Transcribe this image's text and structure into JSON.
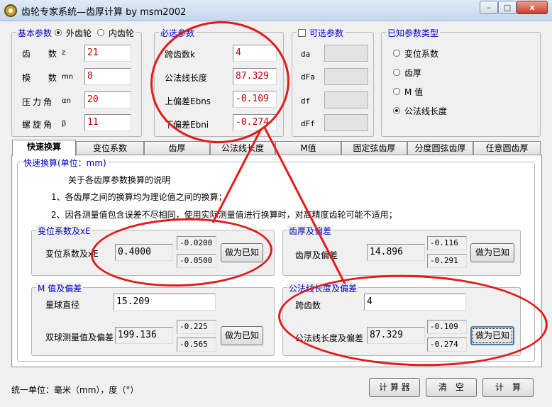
{
  "window": {
    "title": "齿轮专家系统—齿厚计算 by msm2002",
    "controls": [
      "–",
      "□",
      "x"
    ]
  },
  "basic_params": {
    "title": "基本参数",
    "gear_type_external": "外齿轮",
    "gear_type_internal": "内齿轮",
    "selected_gear_type": "外齿轮",
    "rows": [
      {
        "label": "齿　 数",
        "sub": "z",
        "value": "21"
      },
      {
        "label": "模　 数",
        "sub": "mn",
        "value": "8"
      },
      {
        "label": "压力角",
        "sub": "αn",
        "value": "20"
      },
      {
        "label": "螺旋角",
        "sub": "β",
        "value": "11"
      }
    ]
  },
  "required_params": {
    "title": "必选参数",
    "rows": [
      {
        "label": "跨齿数k",
        "value": "4"
      },
      {
        "label": "公法线长度",
        "value": "87.329"
      },
      {
        "label": "上偏差Ebns",
        "value": "-0.109"
      },
      {
        "label": "下偏差Ebni",
        "value": "-0.274"
      }
    ]
  },
  "optional_params": {
    "title": "可选参数",
    "checked": false,
    "rows": [
      {
        "label": "da",
        "value": ""
      },
      {
        "label": "dFa",
        "value": ""
      },
      {
        "label": "df",
        "value": ""
      },
      {
        "label": "dFf",
        "value": ""
      }
    ]
  },
  "known_param_type": {
    "title": "已知参数类型",
    "options": [
      "变位系数",
      "齿厚",
      "M 值",
      "公法线长度"
    ],
    "selected": "公法线长度"
  },
  "tabs": [
    "快速换算",
    "变位系数",
    "齿厚",
    "公法线长度",
    "M值",
    "固定弦齿厚",
    "分度圆弦齿厚",
    "任意圆齿厚"
  ],
  "active_tab": "快速换算",
  "quick": {
    "title": "快速换算(单位：mm)",
    "notes_title": "关于各齿厚参数换算的说明",
    "note1": "1、各齿厚之间的换算均为理论值之间的换算；",
    "note2": "2、因各测量值包含误差不尽相同，使用实际测量值进行换算时，对高精度齿轮可能不适用；",
    "shift": {
      "title": "变位系数及xE",
      "label": "变位系数及xE",
      "value": "0.4000",
      "upper": "-0.0200",
      "lower": "-0.0500",
      "button": "做为已知"
    },
    "thickness": {
      "title": "齿厚及偏差",
      "label": "齿厚及偏差",
      "value": "14.896",
      "upper": "-0.116",
      "lower": "-0.291",
      "button": "做为已知"
    },
    "m_value": {
      "title": "M 值及偏差",
      "ball_label": "量球直径",
      "ball_value": "15.209",
      "label": "双球测量值及偏差",
      "value": "199.136",
      "upper": "-0.225",
      "lower": "-0.565",
      "button": "做为已知"
    },
    "wk": {
      "title": "公法线长度及偏差",
      "k_label": "跨齿数",
      "k_value": "4",
      "label": "公法线长度及偏差",
      "value": "87.329",
      "upper": "-0.109",
      "lower": "-0.274",
      "button": "做为已知"
    }
  },
  "footer": {
    "units": "统一单位：毫米（mm），度（°）",
    "calculator": "计 算 器",
    "clear": "清　空",
    "compute": "计　算"
  },
  "colors": {
    "group_title": "#0000c8",
    "input_value": "#c00000",
    "annotation": "#e11b1b"
  }
}
